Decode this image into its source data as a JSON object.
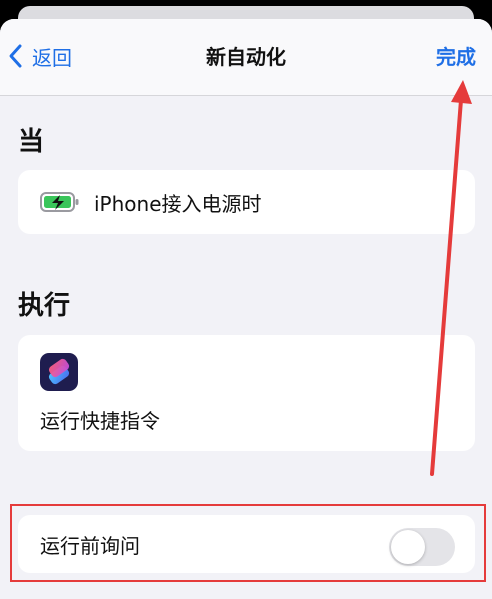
{
  "nav": {
    "back_label": "返回",
    "title": "新自动化",
    "done_label": "完成"
  },
  "sections": {
    "when_header": "当",
    "do_header": "执行"
  },
  "trigger": {
    "label": "iPhone接入电源时",
    "icon": "battery-charging-icon"
  },
  "action": {
    "label": "运行快捷指令",
    "icon": "shortcuts-app-icon"
  },
  "ask_before_running": {
    "label": "运行前询问",
    "enabled": false
  },
  "colors": {
    "accent": "#1f6fe6",
    "annotation": "#e53b3b",
    "background": "#f2f2f7"
  }
}
